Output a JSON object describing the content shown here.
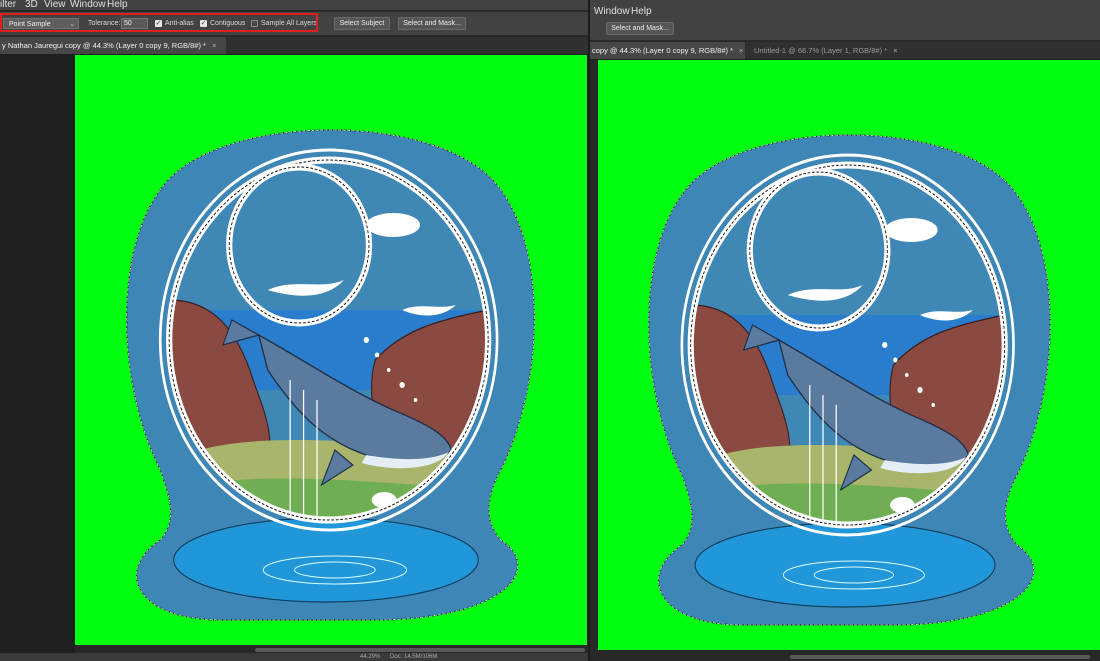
{
  "left": {
    "menu": [
      "Filter",
      "3D",
      "View",
      "Window",
      "Help"
    ],
    "menu_shown": [
      "ilter",
      "3D",
      "View",
      "Window",
      "Help"
    ],
    "options": {
      "sample_select": "Point Sample",
      "tolerance_label": "Tolerance:",
      "tolerance_value": "50",
      "anti_alias_label": "Anti-alias",
      "contiguous_label": "Contiguous",
      "sample_all_layers_label": "Sample All Layers",
      "anti_alias_checked": true,
      "contiguous_checked": true,
      "sample_all_layers_checked": false,
      "select_subject_label": "Select Subject",
      "select_and_mask_label": "Select and Mask..."
    },
    "tab_title": "y Nathan Jauregui copy @ 44.3% (Layer 0 copy 9, RGB/8#) *",
    "tab_close": "×",
    "status_zoom": "44.29%",
    "status_doc": "Doc: 14.5M/106M"
  },
  "right": {
    "menu": [
      "Window",
      "Help"
    ],
    "select_and_mask_label": "Select and Mask...",
    "tabs": [
      {
        "label": "copy @ 44.3% (Layer 0 copy 9, RGB/8#) *",
        "active": true
      },
      {
        "label": "Untitled-1 @ 66.7% (Layer 1, RGB/8#) *",
        "active": false
      }
    ],
    "tab_close": "×"
  },
  "artwork": {
    "background_color": "#00ff10",
    "frame_color": "#3e86b5",
    "sky_color": "#3f87b5",
    "water_color": "#2196d8",
    "rock_color": "#8a4a42",
    "whale_color": "#5b7aa0",
    "ground_color": "#a8b56a",
    "highlight_color": "#e01f1f"
  }
}
